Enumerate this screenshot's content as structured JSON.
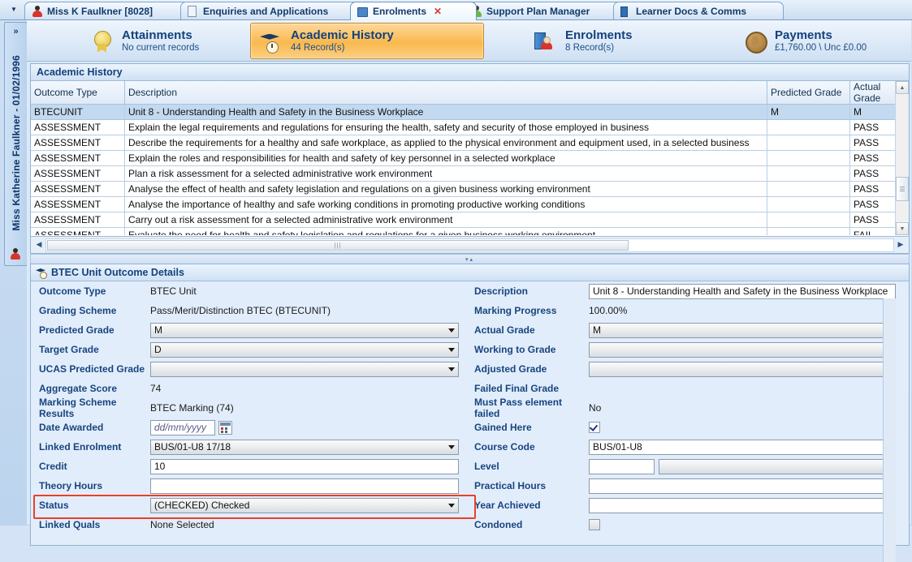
{
  "tabs": [
    {
      "label": "Miss K Faulkner [8028]",
      "icon": "person-icon",
      "active": false,
      "closable": false
    },
    {
      "label": "Enquiries and Applications",
      "icon": "document-icon",
      "active": false,
      "closable": false
    },
    {
      "label": "Enrolments",
      "icon": "folder-icon",
      "active": true,
      "closable": true
    },
    {
      "label": "Support Plan Manager",
      "icon": "person-green-icon",
      "active": false,
      "closable": false
    },
    {
      "label": "Learner Docs & Comms",
      "icon": "book-icon",
      "active": false,
      "closable": false
    }
  ],
  "tab_close_label": "✕",
  "sidebar": {
    "expand_label": "»",
    "learner": "Miss Katherine Faulkner - 01/02/1996",
    "icon": "person-icon"
  },
  "nav": [
    {
      "title": "Attainments",
      "subtitle": "No current records",
      "icon": "rosette-icon",
      "selected": false
    },
    {
      "title": "Academic History",
      "subtitle": "44 Record(s)",
      "icon": "graduation-cap-clock-icon",
      "selected": true
    },
    {
      "title": "Enrolments",
      "subtitle": "8 Record(s)",
      "icon": "books-person-icon",
      "selected": false
    },
    {
      "title": "Payments",
      "subtitle": "£1,760.00 \\ Unc £0.00",
      "icon": "coin-icon",
      "selected": false
    }
  ],
  "grid": {
    "title": "Academic History",
    "columns": [
      "Outcome Type",
      "Description",
      "Predicted Grade",
      "Actual Grade"
    ],
    "rows": [
      {
        "outcome": "BTECUNIT",
        "description": "Unit 8 - Understanding Health and Safety in the Business Workplace",
        "predicted": "M",
        "actual": "M",
        "selected": true,
        "indent": false
      },
      {
        "outcome": "ASSESSMENT",
        "description": "Explain the legal requirements and regulations for ensuring the health, safety and security of those employed in business",
        "predicted": "",
        "actual": "PASS",
        "selected": false,
        "indent": true
      },
      {
        "outcome": "ASSESSMENT",
        "description": "Describe the requirements for a healthy and safe workplace, as applied to the physical environment and equipment used, in a selected business",
        "predicted": "",
        "actual": "PASS",
        "selected": false,
        "indent": true
      },
      {
        "outcome": "ASSESSMENT",
        "description": "Explain the roles and responsibilities for health and safety of key personnel in a selected workplace",
        "predicted": "",
        "actual": "PASS",
        "selected": false,
        "indent": true
      },
      {
        "outcome": "ASSESSMENT",
        "description": "Plan a risk assessment for a selected administrative work environment",
        "predicted": "",
        "actual": "PASS",
        "selected": false,
        "indent": true
      },
      {
        "outcome": "ASSESSMENT",
        "description": "Analyse the effect of health and safety legislation and regulations on a given business working environment",
        "predicted": "",
        "actual": "PASS",
        "selected": false,
        "indent": true
      },
      {
        "outcome": "ASSESSMENT",
        "description": "Analyse the importance of healthy and safe working conditions in promoting productive working conditions",
        "predicted": "",
        "actual": "PASS",
        "selected": false,
        "indent": true
      },
      {
        "outcome": "ASSESSMENT",
        "description": "Carry out a risk assessment for a selected administrative work environment",
        "predicted": "",
        "actual": "PASS",
        "selected": false,
        "indent": true
      },
      {
        "outcome": "ASSESSMENT",
        "description": "Evaluate the need for health and safety legislation and regulations for a given business working environment",
        "predicted": "",
        "actual": "FAIL",
        "selected": false,
        "indent": true
      }
    ]
  },
  "details": {
    "title": "BTEC Unit Outcome Details",
    "left": {
      "outcome_type_label": "Outcome Type",
      "outcome_type_value": "BTEC Unit",
      "grading_scheme_label": "Grading Scheme",
      "grading_scheme_value": "Pass/Merit/Distinction BTEC (BTECUNIT)",
      "predicted_grade_label": "Predicted Grade",
      "predicted_grade_value": "M",
      "target_grade_label": "Target Grade",
      "target_grade_value": "D",
      "ucas_predicted_label": "UCAS Predicted Grade",
      "ucas_predicted_value": "",
      "aggregate_score_label": "Aggregate Score",
      "aggregate_score_value": "74",
      "marking_scheme_label": "Marking Scheme Results",
      "marking_scheme_value": "BTEC Marking (74)",
      "date_awarded_label": "Date Awarded",
      "date_awarded_placeholder": "dd/mm/yyyy",
      "date_awarded_value": "",
      "linked_enrolment_label": "Linked Enrolment",
      "linked_enrolment_value": "BUS/01-U8 17/18",
      "credit_label": "Credit",
      "credit_value": "10",
      "theory_hours_label": "Theory Hours",
      "theory_hours_value": "",
      "status_label": "Status",
      "status_value": "(CHECKED) Checked",
      "linked_quals_label": "Linked Quals",
      "linked_quals_value": "None Selected"
    },
    "right": {
      "description_label": "Description",
      "description_value": "Unit 8 - Understanding Health and Safety in the Business Workplace",
      "marking_progress_label": "Marking Progress",
      "marking_progress_value": "100.00%",
      "actual_grade_label": "Actual Grade",
      "actual_grade_value": "M",
      "working_to_grade_label": "Working to Grade",
      "working_to_grade_value": "",
      "adjusted_grade_label": "Adjusted Grade",
      "adjusted_grade_value": "",
      "failed_final_label": "Failed Final Grade",
      "failed_final_value": "",
      "must_pass_label": "Must Pass element failed",
      "must_pass_value": "No",
      "gained_here_label": "Gained Here",
      "gained_here_checked": true,
      "course_code_label": "Course Code",
      "course_code_value": "BUS/01-U8",
      "level_label": "Level",
      "level_value": "",
      "level_combo_value": "",
      "practical_hours_label": "Practical Hours",
      "practical_hours_value": "",
      "year_achieved_label": "Year Achieved",
      "year_achieved_value": "",
      "condoned_label": "Condoned",
      "condoned_checked": false
    }
  },
  "colors": {
    "accent_blue": "#14417c",
    "selected_orange": "#f8b94f",
    "highlight_red": "#e8402a",
    "panel_bg": "#e2edfb"
  }
}
